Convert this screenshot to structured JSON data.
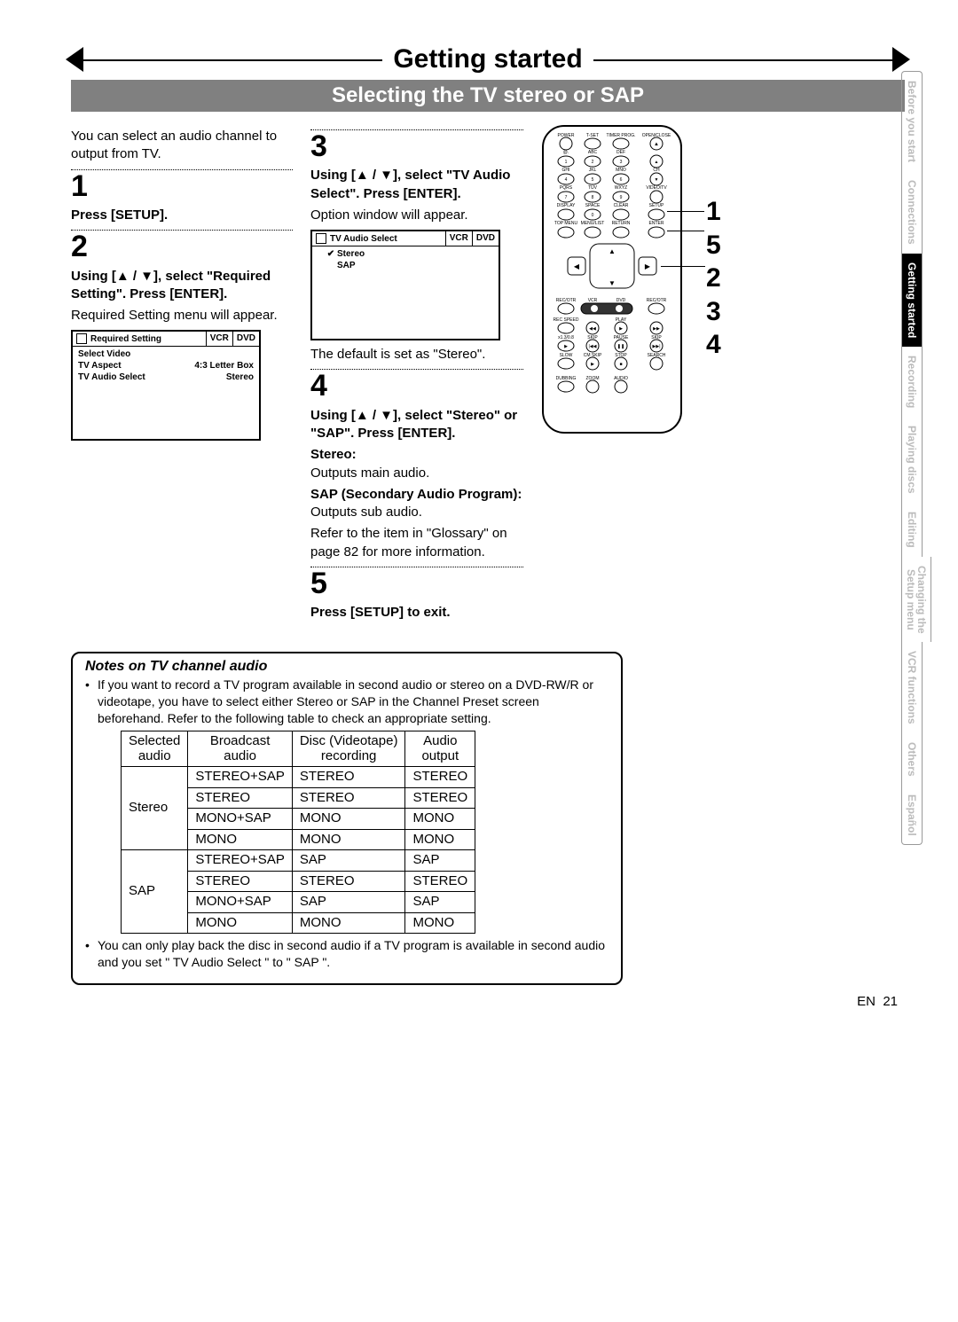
{
  "header": {
    "section": "Getting started",
    "subtitle": "Selecting the TV stereo or SAP"
  },
  "intro": "You can select an audio channel to output from TV.",
  "steps": {
    "s1": {
      "num": "1",
      "line1": "Press [SETUP]."
    },
    "s2": {
      "num": "2",
      "line1": "Using [▲ / ▼], select \"Required Setting\". Press [ENTER].",
      "line2": "Required Setting menu will appear."
    },
    "s3": {
      "num": "3",
      "line1": "Using [▲ / ▼], select \"TV Audio Select\". Press [ENTER].",
      "line2": "Option window will appear.",
      "after": "The default is set as \"Stereo\"."
    },
    "s4": {
      "num": "4",
      "line1": "Using [▲ / ▼], select \"Stereo\" or \"SAP\". Press [ENTER].",
      "stereo_h": "Stereo:",
      "stereo_b": "Outputs main audio.",
      "sap_h": "SAP (Secondary Audio Program):",
      "sap_b": "Outputs sub audio.",
      "ref": "Refer to the item in \"Glossary\" on page 82 for more information."
    },
    "s5": {
      "num": "5",
      "line1": "Press [SETUP] to exit."
    }
  },
  "menu_required": {
    "title": "Required Setting",
    "tabs": [
      "VCR",
      "DVD"
    ],
    "rows": [
      {
        "lbl": "Select Video",
        "val": ""
      },
      {
        "lbl": "TV Aspect",
        "val": "4:3 Letter Box"
      },
      {
        "lbl": "TV Audio Select",
        "val": "Stereo"
      }
    ]
  },
  "menu_audio": {
    "title": "TV Audio Select",
    "tabs": [
      "VCR",
      "DVD"
    ],
    "rows": [
      {
        "check": true,
        "lbl": "Stereo"
      },
      {
        "check": false,
        "lbl": "SAP"
      }
    ]
  },
  "notes": {
    "title": "Notes on TV channel audio",
    "b1": "If you want to record a TV program available in second audio or stereo on a DVD-RW/R or videotape, you have to select either Stereo or SAP in the Channel Preset screen beforehand. Refer to the following table to check an appropriate setting.",
    "b2": "You can only play back the disc in second audio if a TV program is available in second audio and you set \" TV Audio Select \" to \" SAP \"."
  },
  "audio_table": {
    "headers": [
      "Selected\naudio",
      "Broadcast\naudio",
      "Disc (Videotape)\nrecording",
      "Audio\noutput"
    ],
    "rows": [
      [
        "Stereo",
        "STEREO+SAP",
        "STEREO",
        "STEREO"
      ],
      [
        "",
        "STEREO",
        "STEREO",
        "STEREO"
      ],
      [
        "",
        "MONO+SAP",
        "MONO",
        "MONO"
      ],
      [
        "",
        "MONO",
        "MONO",
        "MONO"
      ],
      [
        "SAP",
        "STEREO+SAP",
        "SAP",
        "SAP"
      ],
      [
        "",
        "STEREO",
        "STEREO",
        "STEREO"
      ],
      [
        "",
        "MONO+SAP",
        "SAP",
        "SAP"
      ],
      [
        "",
        "MONO",
        "MONO",
        "MONO"
      ]
    ]
  },
  "remote_callouts": [
    "1",
    "5",
    "2",
    "3",
    "4"
  ],
  "remote_labels": {
    "top_row": [
      "POWER",
      "T-SET",
      "TIMER PROG.",
      "OPEN/CLOSE"
    ],
    "nums_row1": [
      "@.",
      "ABC",
      "DEF"
    ],
    "nums_row1_vals": [
      "1",
      "2",
      "3"
    ],
    "nums_row2": [
      "GHI",
      "JKL",
      "MNO",
      "CH"
    ],
    "nums_row2_vals": [
      "4",
      "5",
      "6"
    ],
    "nums_row3": [
      "PQRS",
      "TUV",
      "WXYZ",
      "VIDEO/TV"
    ],
    "nums_row3_vals": [
      "7",
      "8",
      "9"
    ],
    "nums_row4": [
      "DISPLAY",
      "SPACE",
      "CLEAR",
      "SETUP"
    ],
    "nums_row4_vals": [
      "",
      "0",
      "",
      ""
    ],
    "menu_row": [
      "TOP MENU",
      "MENU/LIST",
      "RETURN",
      "ENTER"
    ],
    "mode_row": [
      "REC/OTR",
      "VCR",
      "DVD",
      "REC/OTR"
    ],
    "recspeed": "REC SPEED",
    "play": "PLAY",
    "trans_row1": [
      "",
      "SKIP",
      "PAUSE",
      "SKIP"
    ],
    "trans_row2": [
      "SLOW",
      "CM SKIP",
      "STOP",
      "SEARCH"
    ],
    "bottom_row": [
      "DUBBING",
      "ZOOM",
      "AUDIO"
    ],
    "speed": "x1.3/0.8"
  },
  "side_tabs": [
    "Before you start",
    "Connections",
    "Getting started",
    "Recording",
    "Playing discs",
    "Editing",
    "Changing the\nSetup menu",
    "VCR functions",
    "Others",
    "Español"
  ],
  "page_num_prefix": "EN",
  "page_num": "21"
}
